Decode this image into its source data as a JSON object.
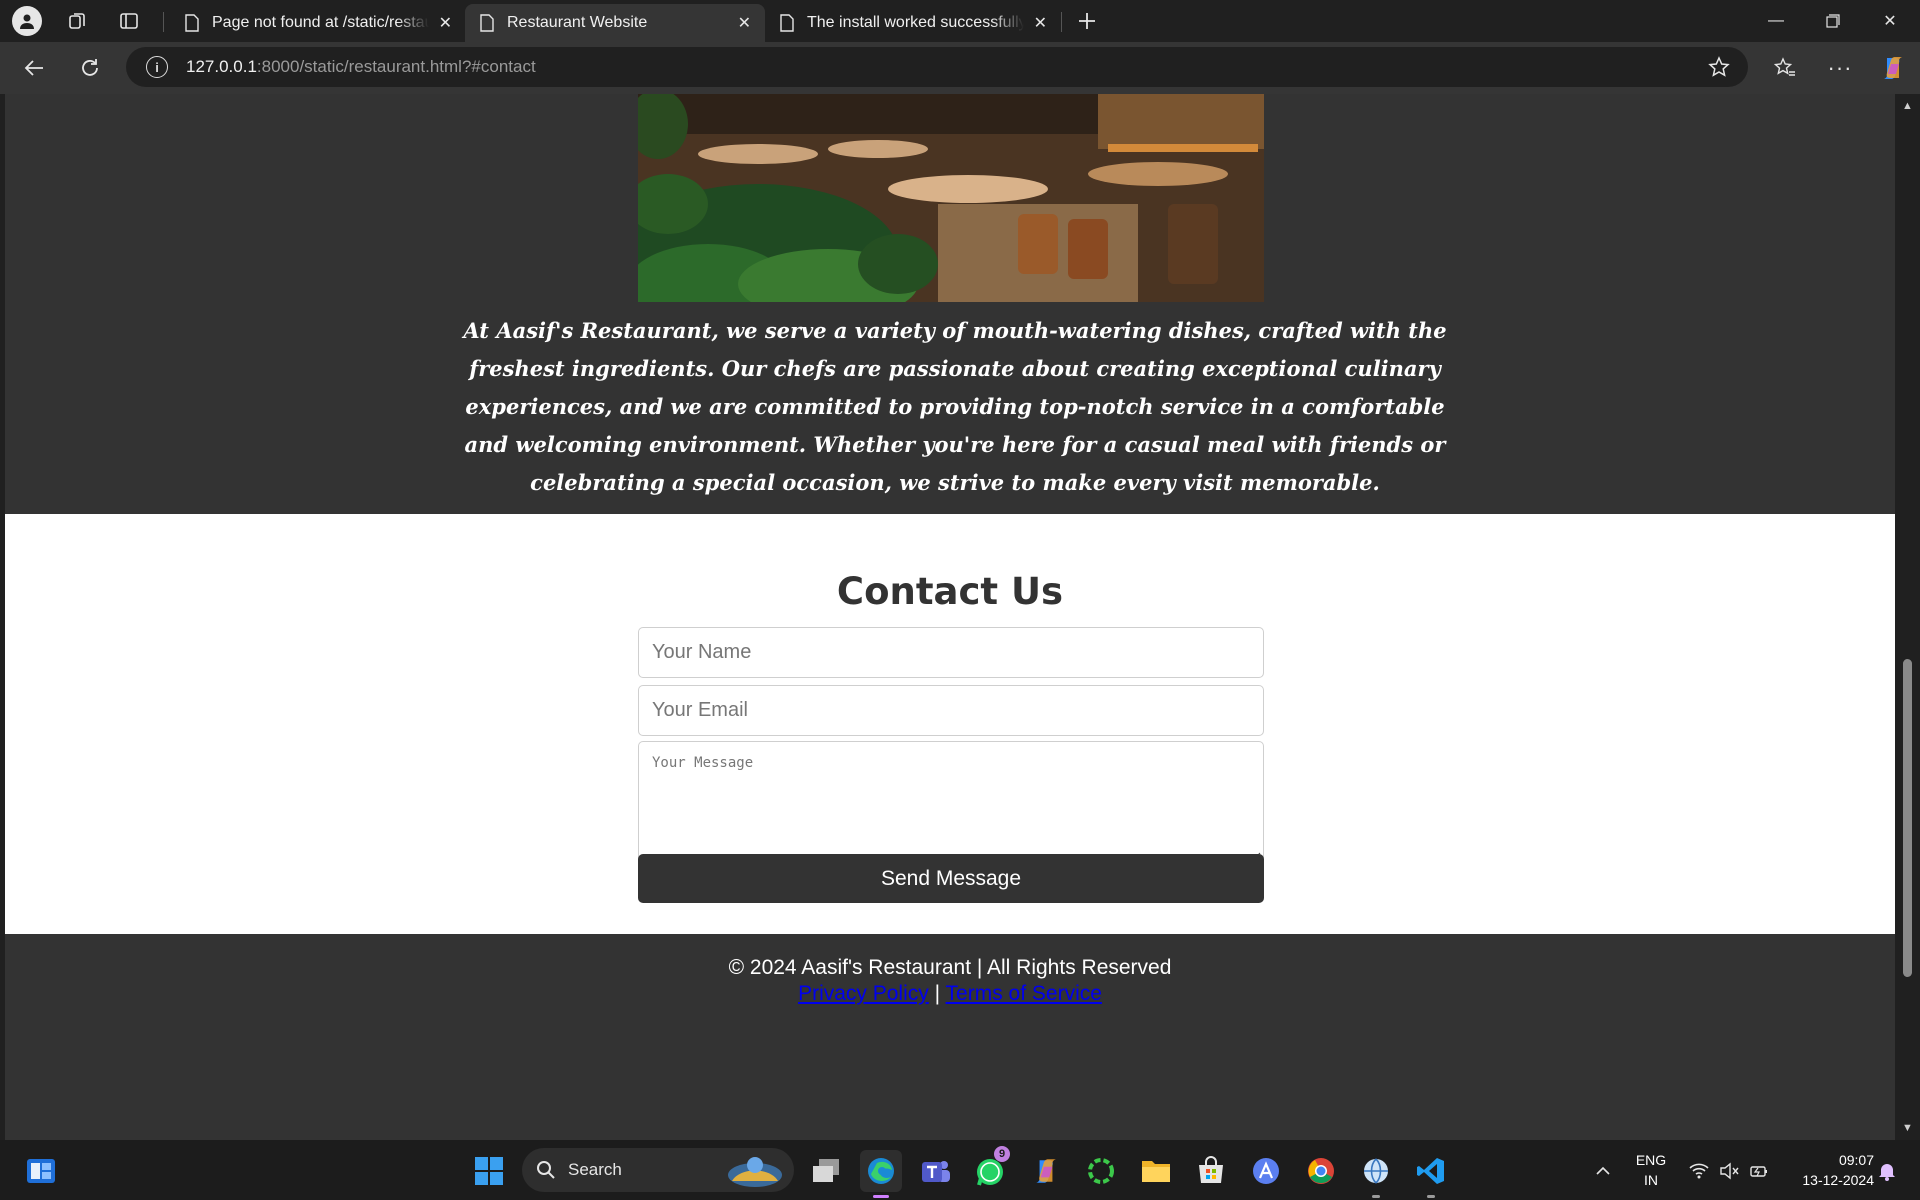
{
  "browser": {
    "tabs": [
      {
        "title": "Page not found at /static/restaurant.html",
        "active": false
      },
      {
        "title": "Restaurant Website",
        "active": true
      },
      {
        "title": "The install worked successfully! Congratulations!",
        "active": false
      }
    ],
    "url_host": "127.0.0.1",
    "url_rest": ":8000/static/restaurant.html?#contact"
  },
  "page": {
    "about_text": "At Aasif's Restaurant, we serve a variety of mouth-watering dishes, crafted with the freshest ingredients. Our chefs are passionate about creating exceptional culinary experiences, and we are committed to providing top-notch service in a comfortable and welcoming environment. Whether you're here for a casual meal with friends or celebrating a special occasion, we strive to make every visit memorable.",
    "contact": {
      "title": "Contact Us",
      "name_placeholder": "Your Name",
      "email_placeholder": "Your Email",
      "message_placeholder": "Your Message",
      "send_label": "Send Message"
    },
    "footer": {
      "copyright": "© 2024 Aasif's Restaurant | All Rights Reserved",
      "privacy": "Privacy Policy",
      "separator": "|",
      "terms": "Terms of Service"
    }
  },
  "taskbar": {
    "search_label": "Search",
    "whatsapp_badge": "9",
    "lang_line1": "ENG",
    "lang_line2": "IN",
    "time": "09:07",
    "date": "13-12-2024"
  }
}
